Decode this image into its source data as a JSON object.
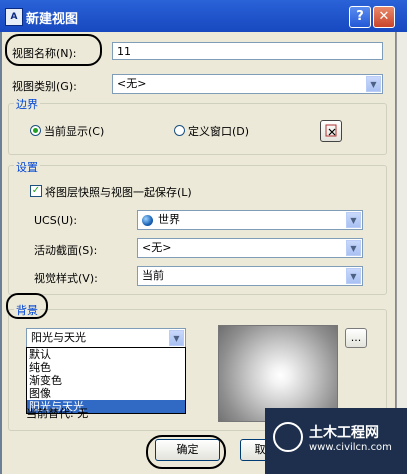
{
  "window": {
    "title": "新建视图",
    "app_icon": "A",
    "help": "?",
    "close": "✕"
  },
  "view_name": {
    "label": "视图名称(N):",
    "value": "11"
  },
  "view_category": {
    "label": "视图类别(G):",
    "value": "<无>"
  },
  "boundary": {
    "title": "边界",
    "current_display": "当前显示(C)",
    "define_window": "定义窗口(D)"
  },
  "settings": {
    "title": "设置",
    "save_layer_snapshot": "将图层快照与视图一起保存(L)",
    "ucs_label": "UCS(U):",
    "ucs_value": "世界",
    "section_label": "活动截面(S):",
    "section_value": "<无>",
    "visual_style_label": "视觉样式(V):",
    "visual_style_value": "当前"
  },
  "background": {
    "title": "背景",
    "selected": "阳光与天光",
    "options": [
      "默认",
      "纯色",
      "渐变色",
      "图像",
      "阳光与天光"
    ],
    "override_text": "当前替代: 无",
    "browse": "..."
  },
  "buttons": {
    "ok": "确定",
    "cancel": "取"
  },
  "watermark": {
    "brand": "土木工程网",
    "url": "www.civilcn.com"
  }
}
